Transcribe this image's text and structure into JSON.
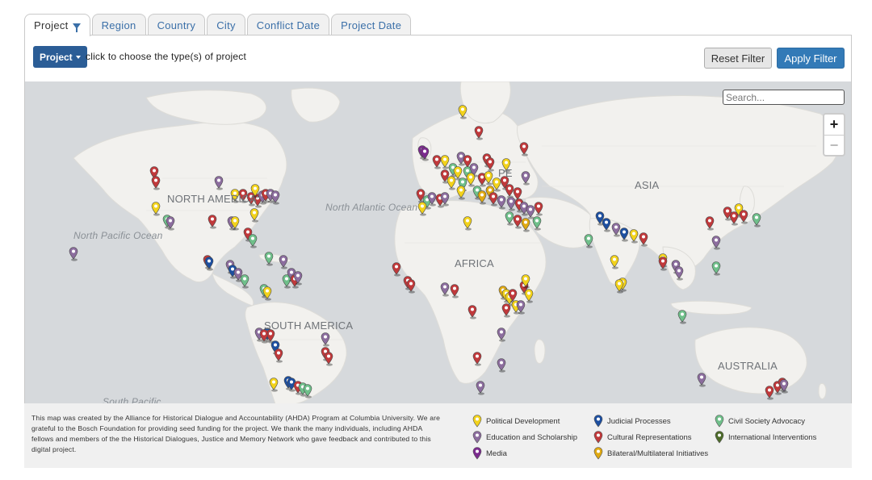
{
  "tabs": [
    {
      "label": "Project",
      "active": true
    },
    {
      "label": "Region"
    },
    {
      "label": "Country"
    },
    {
      "label": "City"
    },
    {
      "label": "Conflict Date"
    },
    {
      "label": "Project Date"
    }
  ],
  "filter": {
    "dropdown_label": "Project",
    "hint": "click to choose the type(s) of project",
    "reset_label": "Reset Filter",
    "apply_label": "Apply Filter"
  },
  "map": {
    "search_placeholder": "Search...",
    "zoom_in": "+",
    "zoom_out": "−",
    "labels": {
      "north_america": "NORTH AMERICA",
      "south_america": "SOUTH AMERICA",
      "africa": "AFRICA",
      "asia": "ASIA",
      "australia": "AUSTRALIA",
      "europe_partial": "PE",
      "north_atlantic": "North Atlantic Ocean",
      "north_pacific": "North Pacific Ocean",
      "south_pacific": "South Pacific"
    }
  },
  "footer": {
    "credit": "This map was created by the Alliance for Historical Dialogue and Accountability (AHDA) Program at Columbia University. We are grateful to the Bosch Foundation for providing seed funding for the project. We thank the many individuals, including AHDA fellows and members of the the Historical Dialogues, Justice and Memory Network who gave feedback and contributed to this digital project."
  },
  "legend": [
    {
      "key": "political",
      "label": "Political Development",
      "color": "#f2d21b"
    },
    {
      "key": "education",
      "label": "Education and Scholarship",
      "color": "#8c6d9e"
    },
    {
      "key": "media",
      "label": "Media",
      "color": "#7b2a8e"
    },
    {
      "key": "judicial",
      "label": "Judicial Processes",
      "color": "#1d4fa0"
    },
    {
      "key": "cultural",
      "label": "Cultural Representations",
      "color": "#c0393b"
    },
    {
      "key": "bilateral",
      "label": "Bilateral/Multilateral Initiatives",
      "color": "#e0a912"
    },
    {
      "key": "civil",
      "label": "Civil Society Advocacy",
      "color": "#6fbf8a"
    },
    {
      "key": "international",
      "label": "International Interventions",
      "color": "#4d6b2a"
    }
  ]
}
